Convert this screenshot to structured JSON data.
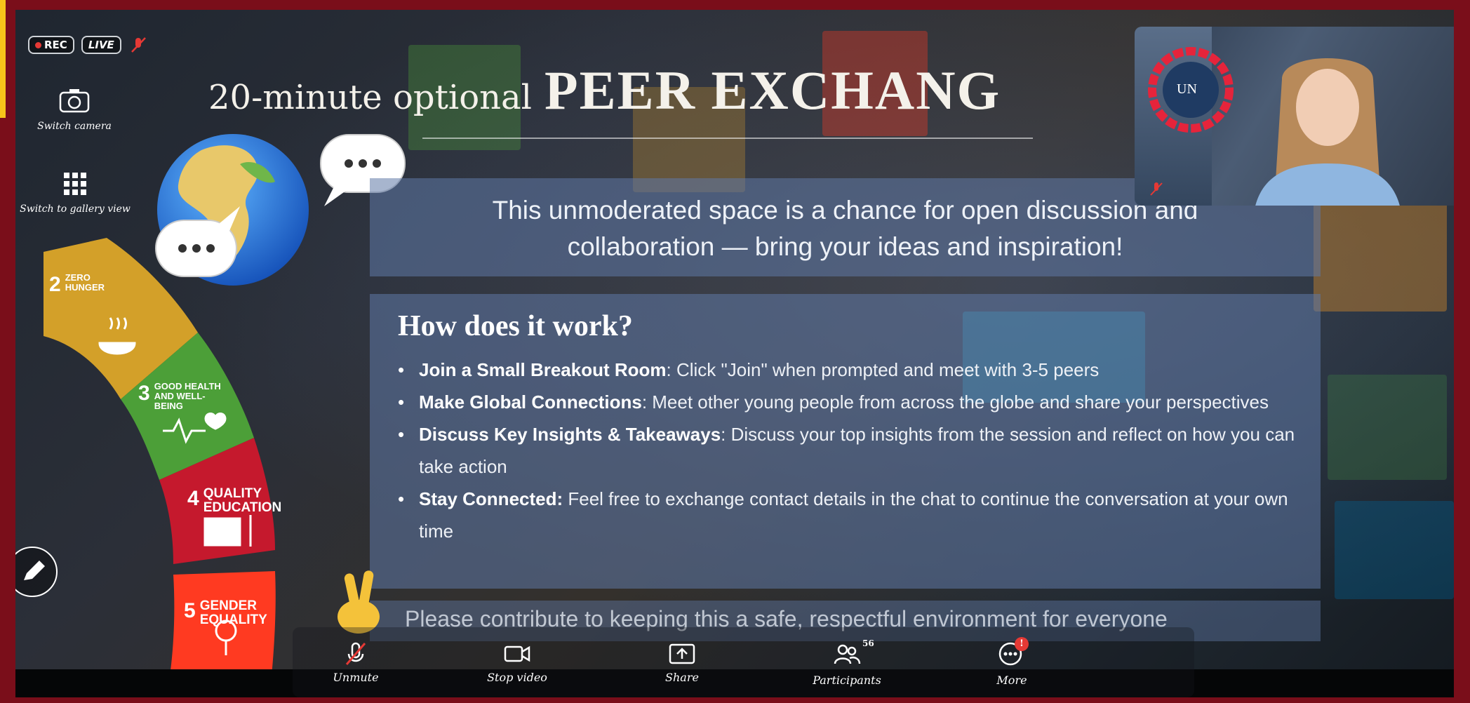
{
  "topbar": {
    "rec_label": "REC",
    "live_label": "LIVE"
  },
  "side_buttons": {
    "switch_camera": "Switch camera",
    "gallery_view": "Switch to gallery view"
  },
  "slide": {
    "title_light": "20-minute optional",
    "title_bold": "PEER EXCHANG",
    "intro_line1": "This unmoderated space is a chance for open discussion and",
    "intro_line2": "collaboration — bring your ideas and inspiration!",
    "how_title": "How does it work?",
    "items": [
      {
        "bold": "Join a Small Breakout Room",
        "text": ":  Click \"Join\" when prompted and meet with 3-5 peers"
      },
      {
        "bold": "Make Global Connections",
        "text": ": Meet other young people from across the globe and share your perspectives"
      },
      {
        "bold": "Discuss Key Insights & Takeaways",
        "text": ": Discuss your top insights from the session and reflect on how you can take action"
      },
      {
        "bold": "Stay Connected:",
        "text": " Feel free to exchange contact details in the chat to continue the conversation at your own time"
      }
    ],
    "footer": "Please contribute to keeping this a safe, respectful environment for everyone"
  },
  "sdg": {
    "goal2": {
      "num": "2",
      "label": "ZERO HUNGER",
      "color": "#d3a029"
    },
    "goal3": {
      "num": "3",
      "label": "GOOD HEALTH AND WELL-BEING",
      "color": "#4c9f38"
    },
    "goal4": {
      "num": "4",
      "label": "QUALITY EDUCATION",
      "color": "#c5192d"
    },
    "goal5": {
      "num": "5",
      "label": "GENDER EQUALITY",
      "color": "#ff3a21"
    }
  },
  "pip": {
    "logo_text": "UN"
  },
  "controls": {
    "unmute": "Unmute",
    "stop_video": "Stop video",
    "share": "Share",
    "participants": "Participants",
    "participants_count": "56",
    "more": "More",
    "more_badge": "!"
  }
}
